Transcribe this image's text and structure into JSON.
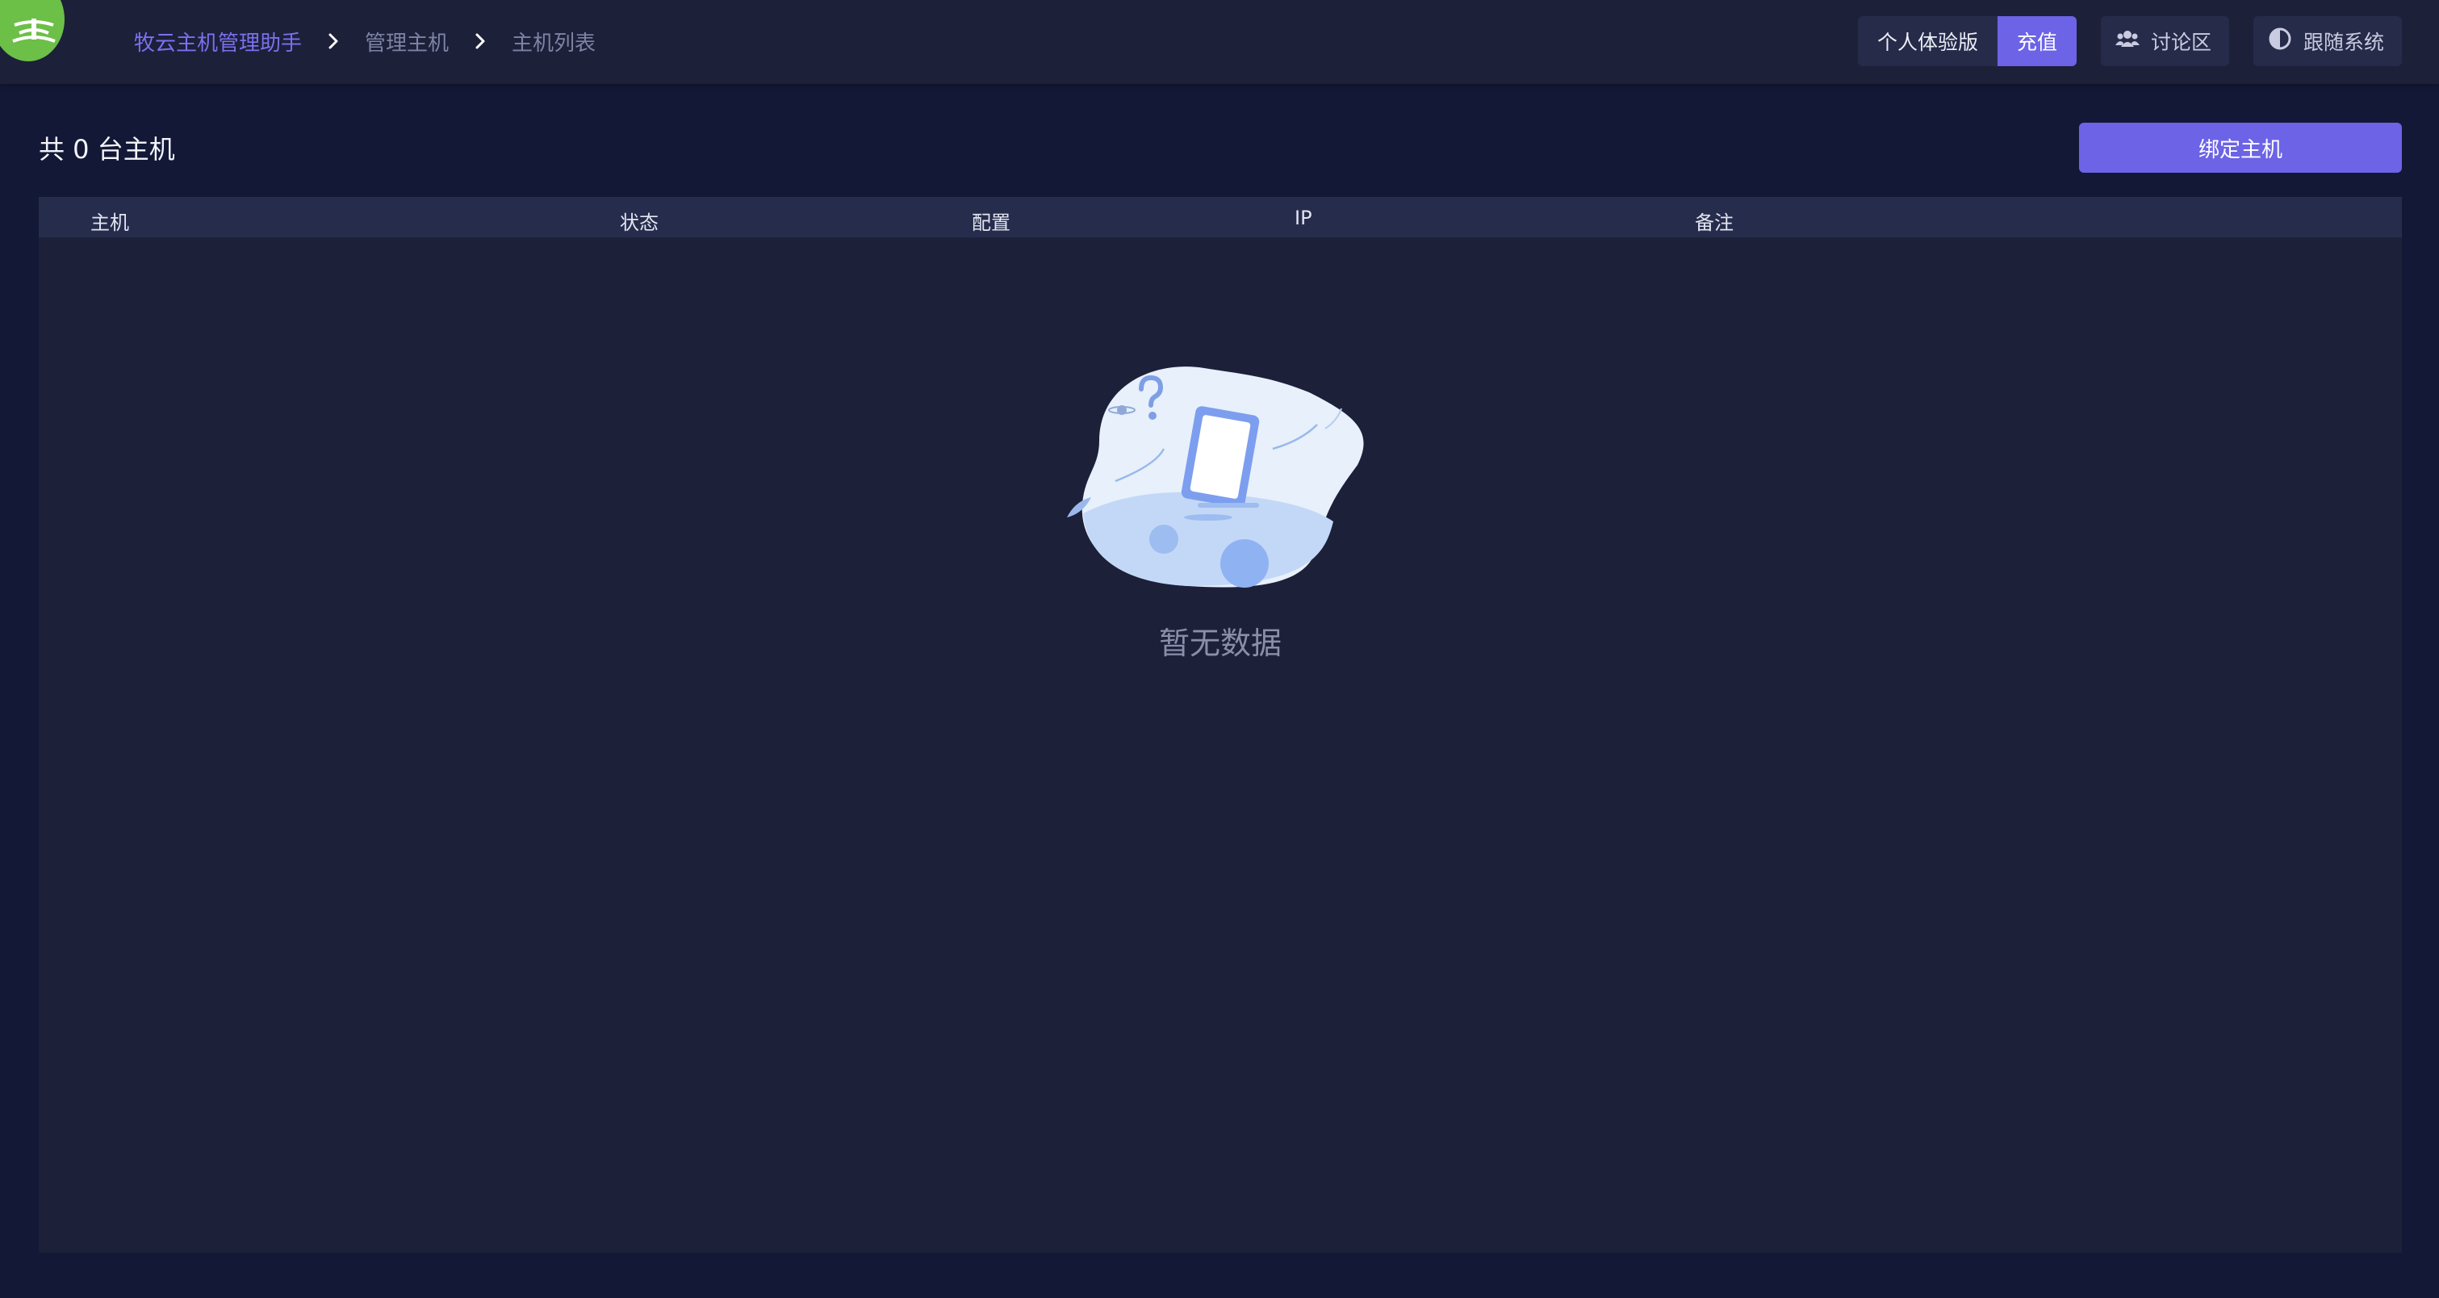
{
  "breadcrumb": {
    "items": [
      "牧云主机管理助手",
      "管理主机",
      "主机列表"
    ]
  },
  "header": {
    "plan_label": "个人体验版",
    "recharge_label": "充值",
    "forum_label": "讨论区",
    "theme_label": "跟随系统"
  },
  "main": {
    "title": "共 0 台主机",
    "bind_button_label": "绑定主机"
  },
  "table": {
    "columns": [
      "主机",
      "状态",
      "配置",
      "IP",
      "备注"
    ],
    "rows": [],
    "empty_text": "暂无数据"
  },
  "colors": {
    "accent": "#6c63e6",
    "logo": "#6cbf47",
    "background": "#131836",
    "panel": "#1c2039"
  },
  "icons": [
    "logo-icon",
    "chevron-right-icon",
    "users-icon",
    "half-circle-theme-icon",
    "empty-illustration"
  ]
}
